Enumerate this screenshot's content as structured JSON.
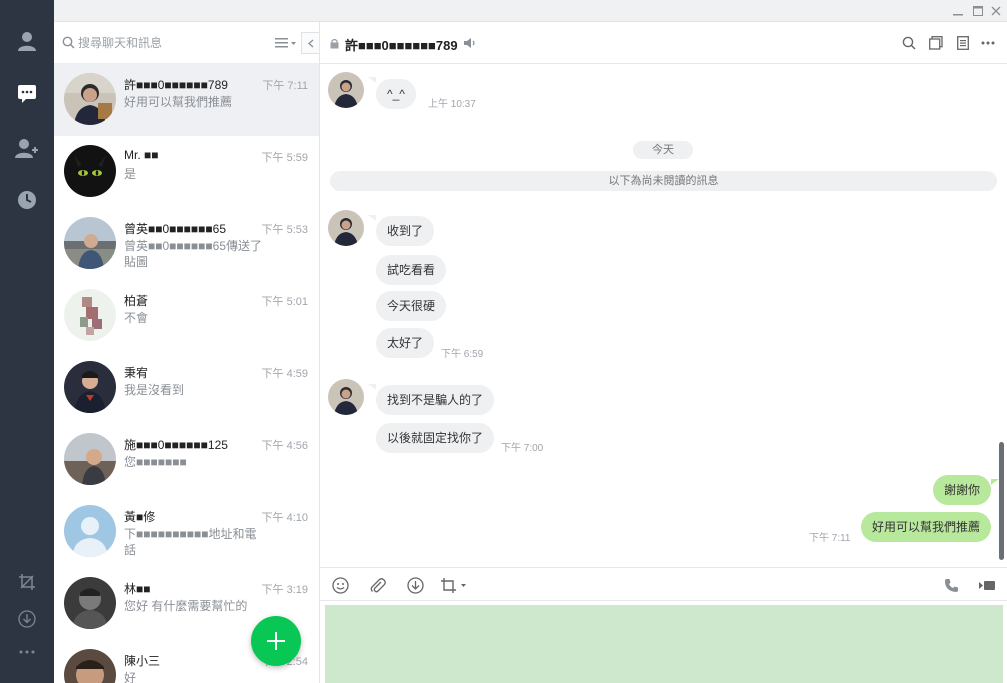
{
  "window": {
    "buttons": [
      {
        "name": "minimize-button",
        "icon": "minimize-icon"
      },
      {
        "name": "maximize-button",
        "icon": "maximize-icon"
      },
      {
        "name": "close-button",
        "icon": "close-icon"
      }
    ]
  },
  "nav": {
    "top_icons": [
      "profile-icon",
      "chat-icon",
      "add-friend-icon",
      "history-clock-icon"
    ],
    "bottom_icons": [
      "screenshot-crop-icon",
      "download-icon",
      "more-dots-icon"
    ],
    "accent": "#ffffff",
    "background": "#2d3543"
  },
  "search": {
    "placeholder": "搜尋聊天和訊息"
  },
  "chats": [
    {
      "name": "許■■■0■■■■■■789",
      "time": "下午 7:11",
      "preview": "好用可以幫我們推薦",
      "active": true
    },
    {
      "name": "Mr. ■■",
      "time": "下午 5:59",
      "preview": "是"
    },
    {
      "name": "曾英■■0■■■■■■65",
      "time": "下午 5:53",
      "preview": "曾英■■0■■■■■■65傳送了貼圖"
    },
    {
      "name": "柏蒼",
      "time": "下午 5:01",
      "preview": "不會"
    },
    {
      "name": "秉宥",
      "time": "下午 4:59",
      "preview": "我是沒看到"
    },
    {
      "name": "施■■■0■■■■■■125",
      "time": "下午 4:56",
      "preview": "您■■■■■■■"
    },
    {
      "name": "黃■修",
      "time": "下午 4:10",
      "preview": "下■■■■■■■■■■地址和電話"
    },
    {
      "name": "林■■",
      "time": "下午 3:19",
      "preview": "您好 有什麼需要幫忙的"
    },
    {
      "name": "陳小三",
      "time": "下午 2:54",
      "preview": "好"
    }
  ],
  "conversation": {
    "title": "許■■■0■■■■■■789",
    "header_icons": [
      "search-icon",
      "album-icon",
      "notes-icon",
      "more-icon"
    ],
    "date_divider": "今天",
    "unread_divider": "以下為尚未閱讀的訊息",
    "messages": [
      {
        "dir": "in",
        "text": "^_^",
        "time": "上午 10:37"
      },
      {
        "dir": "in",
        "text": "收到了",
        "time": ""
      },
      {
        "dir": "in",
        "text": "試吃看看",
        "time": ""
      },
      {
        "dir": "in",
        "text": "今天很硬",
        "time": ""
      },
      {
        "dir": "in",
        "text": "太好了",
        "time": "下午 6:59"
      },
      {
        "dir": "in",
        "text": "找到不是騙人的了",
        "time": ""
      },
      {
        "dir": "in",
        "text": "以後就固定找你了",
        "time": "下午 7:00"
      },
      {
        "dir": "out",
        "text": "謝謝你",
        "time": ""
      },
      {
        "dir": "out",
        "text": "好用可以幫我們推薦",
        "time": "下午 7:11"
      }
    ]
  },
  "composer": {
    "toolbar_icons": [
      "emoji-icon",
      "attach-icon",
      "save-download-icon",
      "crop-capture-icon",
      "voice-call-icon",
      "video-call-icon"
    ],
    "input_value": "",
    "input_bg": "#cde8cd"
  },
  "colors": {
    "line_green": "#08c755",
    "bubble_out": "#b7e89b",
    "bubble_in": "#eef0f2"
  }
}
